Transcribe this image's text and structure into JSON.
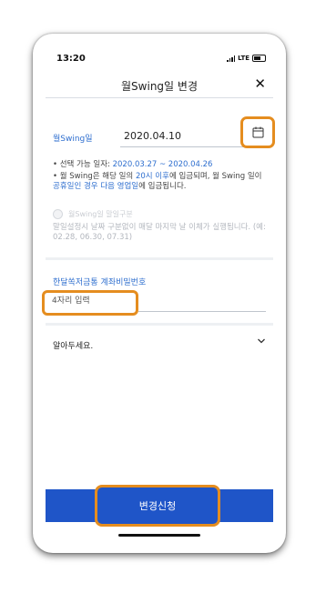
{
  "status_bar": {
    "time": "13:20",
    "network": "LTE"
  },
  "header": {
    "title": "월Swing일 변경",
    "close_glyph": "✕"
  },
  "date_field": {
    "label": "월Swing일",
    "value": "2020.04.10"
  },
  "info": {
    "range_prefix": "선택 가능 일자: ",
    "range_value": "2020.03.27 ~ 2020.04.26",
    "note_part1": "월 Swing은 해당 일의 ",
    "note_hl1": "20시 이후",
    "note_part2": "에 입금되며, 월 Swing 일이 ",
    "note_hl2": "공휴일인 경우 다음 영업일",
    "note_part3": "에 입금됩니다."
  },
  "end_option": {
    "label": "월Swing일 말일구분",
    "description": "말일설정시 날짜 구분없이 매달 마지막 날 이체가 실행됩니다. (예: 02.28, 06.30, 07.31)"
  },
  "password": {
    "label": "한달쏙저금통 계좌비밀번호",
    "placeholder": "4자리 입력"
  },
  "notice": {
    "label": "알아두세요."
  },
  "submit": {
    "label": "변경신청"
  },
  "colors": {
    "accent": "#2f6fcf",
    "primary_button": "#1f55c8",
    "highlight_border": "#e58d1f"
  }
}
